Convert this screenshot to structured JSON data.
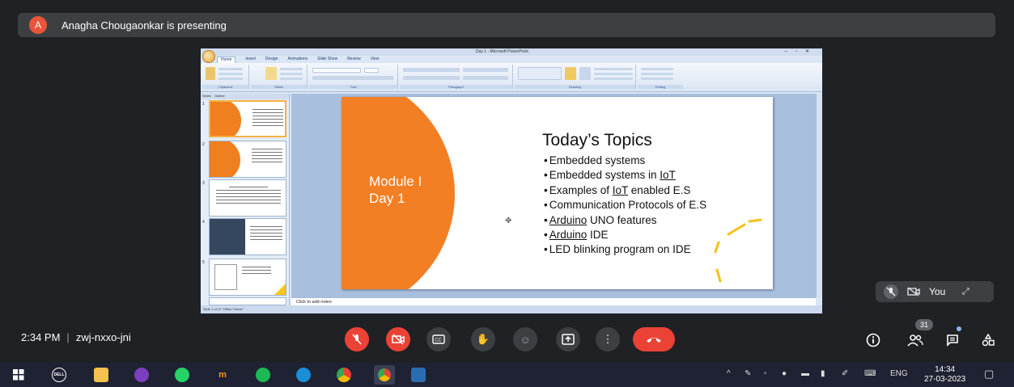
{
  "banner": {
    "avatar_letter": "A",
    "text": "Anagha Chougaonkar is presenting"
  },
  "ppt": {
    "window_title": "Day 1 - Microsoft PowerPoint",
    "menu": [
      "Home",
      "Insert",
      "Design",
      "Animations",
      "Slide Show",
      "Review",
      "View"
    ],
    "ribbon_groups": [
      "Clipboard",
      "Slides",
      "Font",
      "Paragraph",
      "Drawing",
      "Editing"
    ],
    "panel_tabs": [
      "Slides",
      "Outline"
    ],
    "thumbnails": [
      {
        "num": "1",
        "label": "Module I Day 1"
      },
      {
        "num": "2",
        "label": ""
      },
      {
        "num": "3",
        "label": "Embedded systems in IoT"
      },
      {
        "num": "4",
        "label": ""
      },
      {
        "num": "5",
        "label": "The role of embedded systems in IoT"
      }
    ],
    "slide": {
      "module": "Module I",
      "day": "Day 1",
      "title": "Today’s Topics",
      "bullets": [
        [
          "",
          "Embedded systems",
          ""
        ],
        [
          "Embedded systems in ",
          "IoT",
          ""
        ],
        [
          "Examples of ",
          "IoT",
          " enabled E.S"
        ],
        [
          "",
          "Communication Protocols of E.S",
          ""
        ],
        [
          "",
          "Arduino",
          " UNO features"
        ],
        [
          "",
          "Arduino",
          " IDE"
        ],
        [
          "",
          "LED blinking program on IDE",
          ""
        ]
      ]
    },
    "notes_placeholder": "Click to add notes",
    "status": "Slide 1 of 12   \"Office Theme\""
  },
  "self_tile": {
    "label": "You"
  },
  "meeting": {
    "time": "2:34 PM",
    "code": "zwj-nxxo-jni",
    "participants": "31"
  },
  "taskbar": {
    "lang": "ENG",
    "time": "14:34",
    "date": "27-03-2023"
  },
  "colors": {
    "accent_orange": "#f27f24",
    "end_call": "#ea4335",
    "meet_bg": "#202124"
  }
}
